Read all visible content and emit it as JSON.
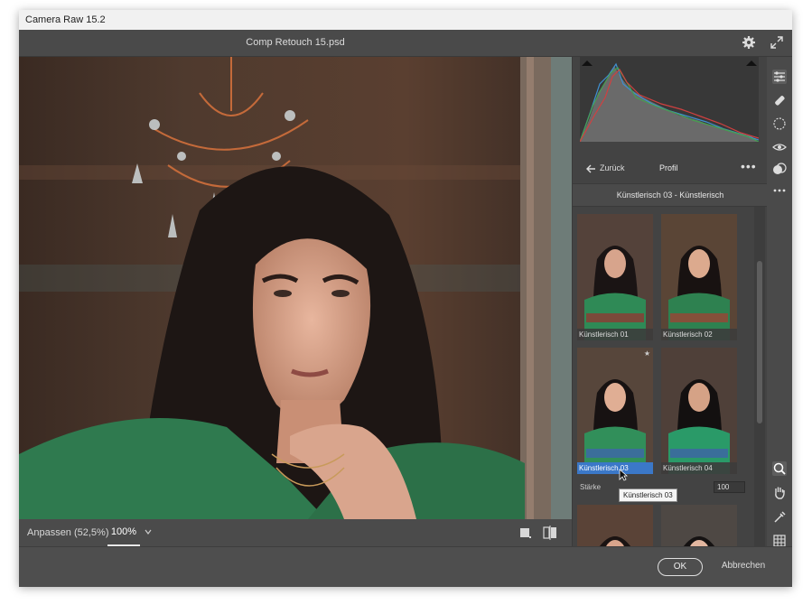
{
  "window": {
    "title": "Camera Raw 15.2"
  },
  "document": {
    "filename": "Comp Retouch 15.psd"
  },
  "zoom": {
    "fit_label": "Anpassen (52,5%)",
    "level": "100%"
  },
  "profile_panel": {
    "back_label": "Zurück",
    "header_label": "Profil",
    "more_label": "•••",
    "selected_profile": "Künstlerisch 03 - Künstlerisch",
    "thumbnails": [
      {
        "label": "Künstlerisch 01"
      },
      {
        "label": "Künstlerisch 02"
      },
      {
        "label": "Künstlerisch 03"
      },
      {
        "label": "Künstlerisch 04"
      }
    ],
    "strength_label": "Stärke",
    "strength_value": "100",
    "tooltip": "Künstlerisch 03"
  },
  "footer": {
    "ok_label": "OK",
    "cancel_label": "Abbrechen"
  },
  "colors": {
    "accent": "#3b78c8",
    "panel": "#434343",
    "window": "#535353"
  }
}
